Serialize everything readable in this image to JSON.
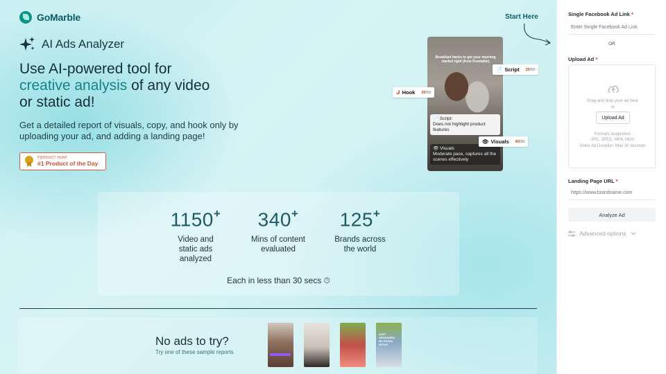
{
  "brand": {
    "name": "GoMarble"
  },
  "header": {
    "start_here": "Start Here"
  },
  "product": {
    "title": "AI Ads Analyzer"
  },
  "hero": {
    "line1": "Use AI-powered tool for",
    "accent": "creative analysis",
    "line2_rest": "of any video",
    "line3": "or static ad!"
  },
  "subtitle": "Get a detailed report of visuals, copy, and hook only by uploading your ad, and adding a landing page!",
  "badge": {
    "small": "PRODUCT HUNT",
    "big": "#1 Product of the Day"
  },
  "preview": {
    "caption": "Breakfast hacks to get your morning started right (from Frootable)",
    "chips": [
      {
        "label": "Script",
        "score": "20",
        "max": "/50"
      },
      {
        "label": "Hook",
        "score": "20",
        "max": "/50"
      },
      {
        "label": "Visuals",
        "score": "40",
        "max": "/50"
      }
    ],
    "script_card": {
      "title": "Script:",
      "text": "Does not highlight product features"
    },
    "visuals_card": {
      "title": "Visuals",
      "text": "Moderate pace, captures all the scenes effectively"
    }
  },
  "stats": {
    "items": [
      {
        "value": "1150",
        "sup": "+",
        "label": "Video and static ads analyzed"
      },
      {
        "value": "340",
        "sup": "+",
        "label": "Mins of content evaluated"
      },
      {
        "value": "125",
        "sup": "+",
        "label": "Brands across the world"
      }
    ],
    "footer": "Each in less than 30 secs ⏱"
  },
  "samples": {
    "title": "No ads to try?",
    "subtitle": "Try one of these sample reports",
    "thumb4_text": "JUST UPGRADED MY PICNIC SETUP"
  },
  "panel": {
    "fb_label": "Single Facebook Ad Link",
    "fb_placeholder": "Enter Single Facebook Ad Link",
    "or": "OR",
    "upload_label": "Upload Ad",
    "drag_line1": "Drag and drop your ad here",
    "drag_line2": "or",
    "upload_button": "Upload Ad",
    "formats_line1": "Formats Supported:",
    "formats_line2": "JPG, JPEG, MP4, MOV",
    "duration": "Video Ad Duration: Max 30 seconds",
    "landing_label": "Landing Page URL",
    "landing_placeholder": "https://www.brandname.com",
    "analyze_button": "Analyze Ad",
    "advanced": "Advanced options"
  },
  "colors": {
    "accent": "#16818a",
    "brand": "#0d9488",
    "required": "#e11d48",
    "badge": "#d4502f"
  }
}
